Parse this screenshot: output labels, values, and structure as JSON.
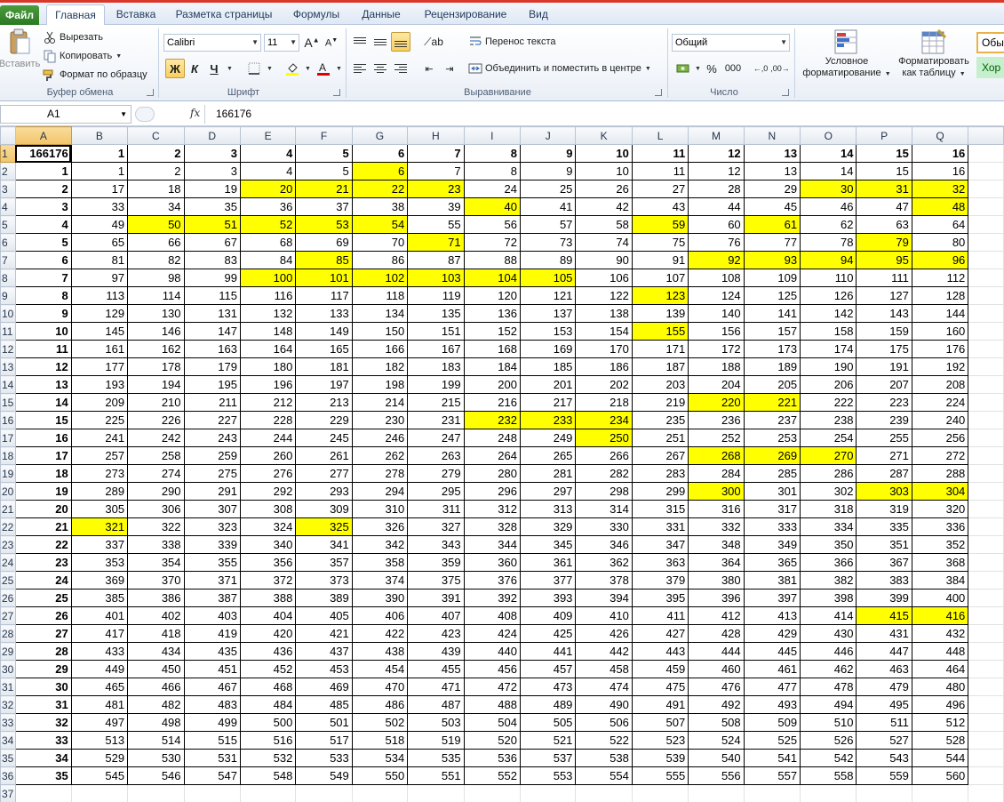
{
  "ribbon_tabs": [
    {
      "label": "Файл"
    },
    {
      "label": "Главная"
    },
    {
      "label": "Вставка"
    },
    {
      "label": "Разметка страницы"
    },
    {
      "label": "Формулы"
    },
    {
      "label": "Данные"
    },
    {
      "label": "Рецензирование"
    },
    {
      "label": "Вид"
    }
  ],
  "active_tab": "Главная",
  "clipboard": {
    "paste_label": "Вставить",
    "cut_label": "Вырезать",
    "copy_label": "Копировать",
    "format_painter_label": "Формат по образцу",
    "group_label": "Буфер обмена"
  },
  "font": {
    "font_name": "Calibri",
    "font_size": "11",
    "bold_label": "Ж",
    "italic_label": "К",
    "underline_label": "Ч",
    "group_label": "Шрифт",
    "highlight_color": "#ffff00",
    "font_color": "#e00000"
  },
  "alignment": {
    "wrap_text_label": "Перенос текста",
    "merge_label": "Объединить и поместить в центре",
    "group_label": "Выравнивание"
  },
  "number": {
    "format_value": "Общий",
    "percent_label": "%",
    "thousands_label": "000",
    "group_label": "Число"
  },
  "styles": {
    "conditional_label_1": "Условное",
    "conditional_label_2": "форматирование",
    "table_label_1": "Форматировать",
    "table_label_2": "как таблицу",
    "style_normal": "Обы",
    "style_good": "Хор"
  },
  "formula_bar": {
    "name_box": "A1",
    "fx_label": "fx",
    "formula_value": "166176"
  },
  "sheet": {
    "columns": [
      "A",
      "B",
      "C",
      "D",
      "E",
      "F",
      "G",
      "H",
      "I",
      "J",
      "K",
      "L",
      "M",
      "N",
      "O",
      "P",
      "Q"
    ],
    "header_row": [
      "166176",
      "1",
      "2",
      "3",
      "4",
      "5",
      "6",
      "7",
      "8",
      "9",
      "10",
      "11",
      "12",
      "13",
      "14",
      "15",
      "16"
    ],
    "data_rows": 35,
    "extra_row_label": "37",
    "highlight_color": "#ffff00",
    "highlight_values": [
      6,
      20,
      21,
      22,
      23,
      30,
      31,
      32,
      40,
      48,
      50,
      51,
      52,
      53,
      54,
      59,
      61,
      71,
      79,
      85,
      92,
      93,
      94,
      95,
      96,
      100,
      101,
      102,
      103,
      104,
      105,
      123,
      155,
      220,
      221,
      232,
      233,
      234,
      250,
      268,
      269,
      270,
      300,
      303,
      304,
      321,
      325,
      415,
      416
    ]
  }
}
